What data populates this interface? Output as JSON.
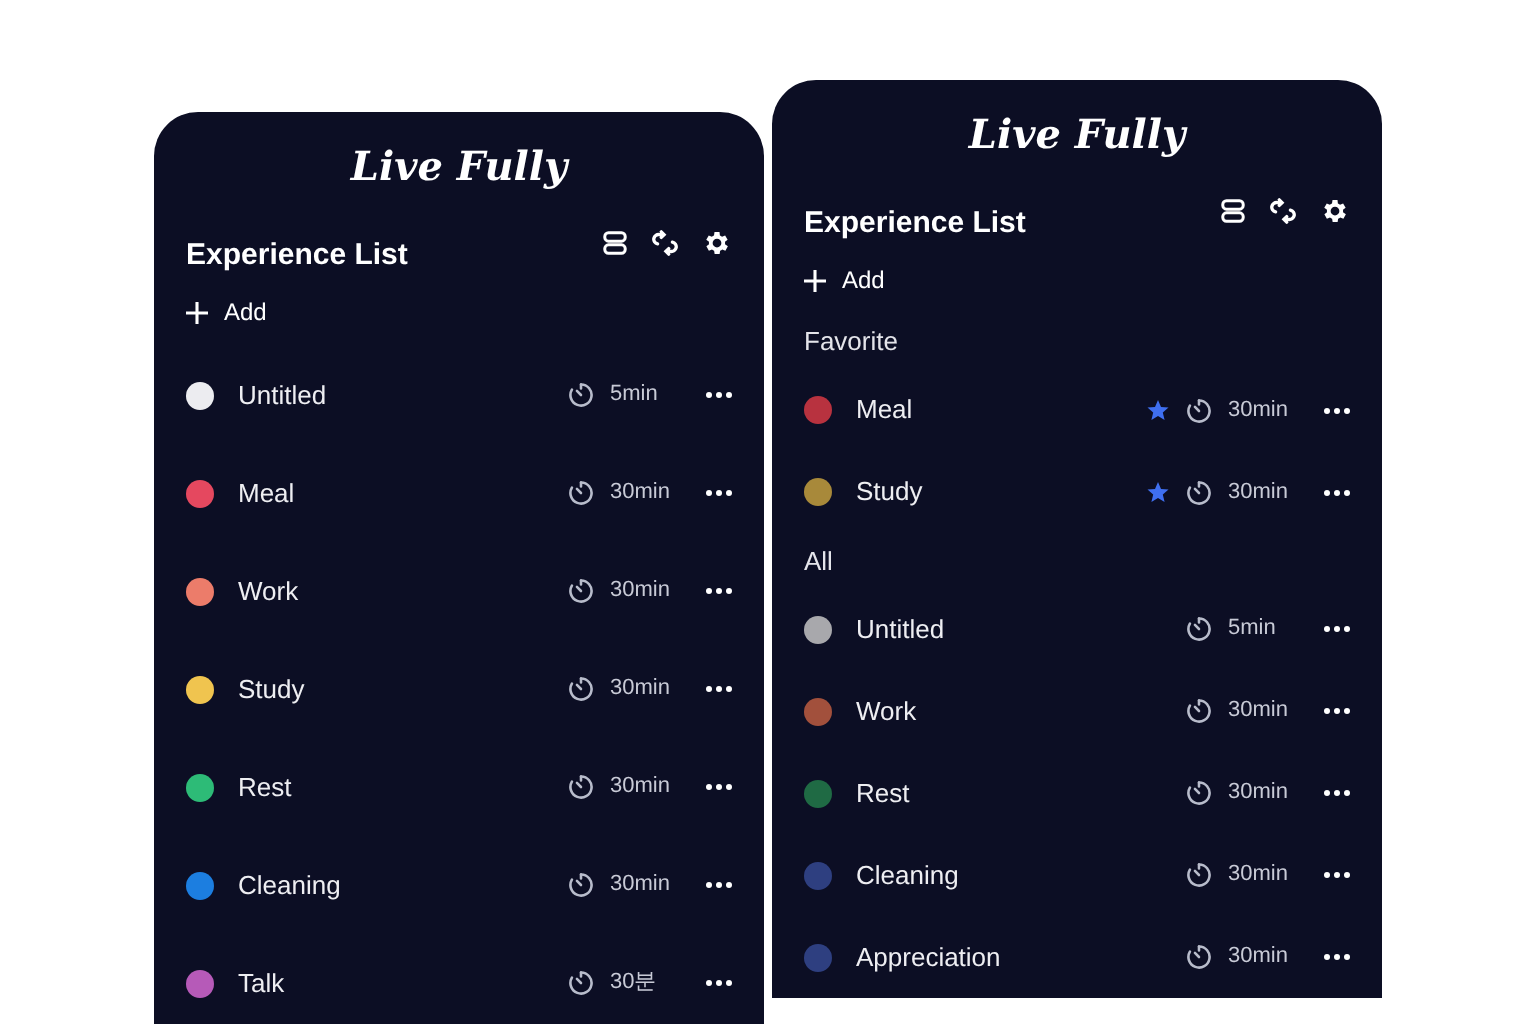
{
  "screens": [
    {
      "app_title": "Live Fully",
      "heading": "Experience List",
      "add_label": "Add",
      "sections": [
        {
          "items": [
            {
              "name": "Untitled",
              "color": "#ececf0",
              "duration": "5min",
              "favorite": false
            },
            {
              "name": "Meal",
              "color": "#e5485f",
              "duration": "30min",
              "favorite": false
            },
            {
              "name": "Work",
              "color": "#ec7c6a",
              "duration": "30min",
              "favorite": false
            },
            {
              "name": "Study",
              "color": "#f0c44f",
              "duration": "30min",
              "favorite": false
            },
            {
              "name": "Rest",
              "color": "#2dbb77",
              "duration": "30min",
              "favorite": false
            },
            {
              "name": "Cleaning",
              "color": "#1c7ee0",
              "duration": "30min",
              "favorite": false
            },
            {
              "name": "Talk",
              "color": "#b65ab8",
              "duration": "30분",
              "favorite": false
            }
          ]
        }
      ]
    },
    {
      "app_title": "Live Fully",
      "heading": "Experience List",
      "add_label": "Add",
      "sections": [
        {
          "title": "Favorite",
          "items": [
            {
              "name": "Meal",
              "color": "#b8323f",
              "duration": "30min",
              "favorite": true
            },
            {
              "name": "Study",
              "color": "#a8893a",
              "duration": "30min",
              "favorite": true
            }
          ]
        },
        {
          "title": "All",
          "items": [
            {
              "name": "Untitled",
              "color": "#a8a8ac",
              "duration": "5min",
              "favorite": false
            },
            {
              "name": "Work",
              "color": "#a2503c",
              "duration": "30min",
              "favorite": false
            },
            {
              "name": "Rest",
              "color": "#1f6a44",
              "duration": "30min",
              "favorite": false
            },
            {
              "name": "Cleaning",
              "color": "#2e3f80",
              "duration": "30min",
              "favorite": false
            },
            {
              "name": "Appreciation",
              "color": "#2e3f80",
              "duration": "30min",
              "favorite": false
            }
          ]
        }
      ]
    }
  ]
}
